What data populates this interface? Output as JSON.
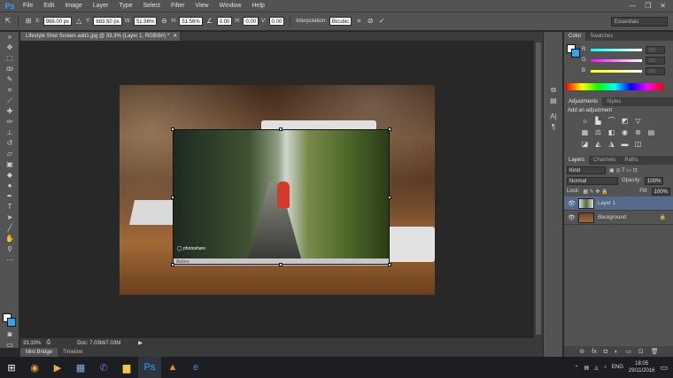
{
  "app": {
    "logo": "Ps"
  },
  "menu": [
    "File",
    "Edit",
    "Image",
    "Layer",
    "Type",
    "Select",
    "Filter",
    "View",
    "Window",
    "Help"
  ],
  "window_controls": {
    "minimize": "—",
    "maximize": "❐",
    "close": "✕"
  },
  "options_bar": {
    "x_label": "X:",
    "x_value": "988.00 px",
    "y_label": "Y:",
    "y_value": "683.50 px",
    "w_label": "W:",
    "w_value": "51.56%",
    "h_label": "H:",
    "h_value": "51.56%",
    "angle_value": "0.00",
    "hskew_label": "H:",
    "hskew_value": "0.00",
    "vskew_label": "V:",
    "vskew_value": "0.00",
    "interp_label": "Interpolation:",
    "interp_value": "Bicubic",
    "workspace": "Essentials"
  },
  "document": {
    "tab_title": "Lifestyle Shot Screen add1.jpg @ 33.3% (Layer 1, RGB/8#) *",
    "screen_logo": "◯ photoshare",
    "bezel_label": "Before"
  },
  "status": {
    "zoom": "33.33%",
    "doc_size": "Doc: 7.03M/7.03M"
  },
  "bottom_tabs": [
    "Mini Bridge",
    "Timeline"
  ],
  "color_panel": {
    "tabs": [
      "Color",
      "Swatches"
    ],
    "channels": [
      {
        "label": "R",
        "value": "255",
        "color": "#ff4a4a"
      },
      {
        "label": "G",
        "value": "255",
        "color": "#e04ae0"
      },
      {
        "label": "B",
        "value": "255",
        "color": "#e8e84a"
      }
    ]
  },
  "adjustments_panel": {
    "tabs": [
      "Adjustments",
      "Styles"
    ],
    "heading": "Add an adjustment"
  },
  "layers_panel": {
    "tabs": [
      "Layers",
      "Channels",
      "Paths"
    ],
    "kind_label": "Kind",
    "blend_mode": "Normal",
    "opacity_label": "Opacity:",
    "opacity_value": "100%",
    "lock_label": "Lock:",
    "fill_label": "Fill:",
    "fill_value": "100%",
    "layers": [
      {
        "name": "Layer 1",
        "selected": true
      },
      {
        "name": "Background",
        "selected": false
      }
    ]
  },
  "taskbar": {
    "language": "ENG",
    "time": "18:05",
    "date": "29/11/2016"
  }
}
